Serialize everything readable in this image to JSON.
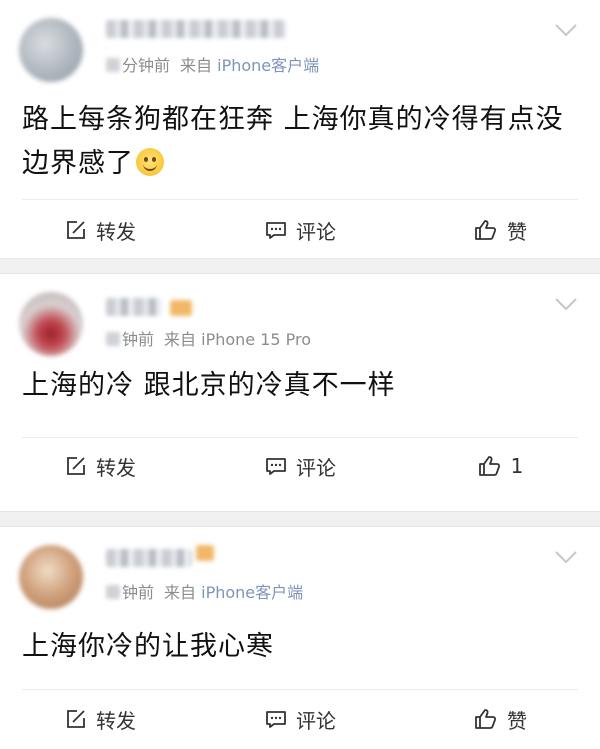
{
  "posts": [
    {
      "meta_suffix": "分钟前",
      "source_prefix": "来自",
      "source_device": "iPhone客户端",
      "content": "路上每条狗都在狂奔 上海你真的冷得有点没边界感了",
      "actions": {
        "repost": "转发",
        "comment": "评论",
        "like": "赞"
      }
    },
    {
      "meta_suffix": "钟前",
      "source_prefix": "来自",
      "source_device": "iPhone 15 Pro",
      "content": "上海的冷 跟北京的冷真不一样",
      "actions": {
        "repost": "转发",
        "comment": "评论",
        "like": "1"
      }
    },
    {
      "meta_suffix": "钟前",
      "source_prefix": "来自",
      "source_device": "iPhone客户端",
      "content": "上海你冷的让我心寒",
      "actions": {
        "repost": "转发",
        "comment": "评论",
        "like": "赞"
      }
    }
  ],
  "icons": {
    "repost": "share-edit-icon",
    "comment": "comment-icon",
    "like": "thumbs-up-icon",
    "expand": "chevron-down-icon",
    "emoji": "smile-emoji-icon"
  },
  "colors": {
    "source_device": "#7f94b8",
    "meta": "#8c8c8c",
    "separator": "#f0f0f0"
  }
}
